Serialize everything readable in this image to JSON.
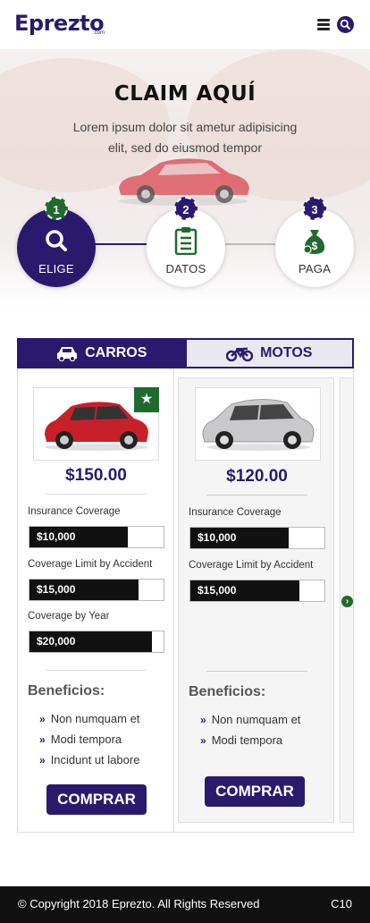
{
  "header": {
    "logo_text": "Eprezto",
    "logo_sub": ".com",
    "menu_icon": "hamburger-icon",
    "search_icon": "search-icon"
  },
  "hero": {
    "title": "CLAIM AQUÍ",
    "subtitle": "Lorem ipsum dolor sit ametur adipisicing elit, sed do eiusmod tempor"
  },
  "steps": [
    {
      "number": "1",
      "label": "ELIGE",
      "icon": "search-icon"
    },
    {
      "number": "2",
      "label": "DATOS",
      "icon": "clipboard-icon"
    },
    {
      "number": "3",
      "label": "PAGA",
      "icon": "money-bag-icon"
    }
  ],
  "tabs": [
    {
      "label": "CARROS",
      "icon": "car-icon",
      "active": true
    },
    {
      "label": "MOTOS",
      "icon": "motorcycle-icon",
      "active": false
    }
  ],
  "plans": [
    {
      "price": "$150.00",
      "car_color": "#c8202a",
      "favorite_icon": "star-icon",
      "coverages": [
        {
          "label": "Insurance Coverage",
          "value": "$10,000",
          "fill_fraction": 0.73
        },
        {
          "label": "Coverage Limit by Accident",
          "value": "$15,000",
          "fill_fraction": 0.81
        },
        {
          "label": "Coverage by Year",
          "value": "$20,000",
          "fill_fraction": 0.91
        }
      ],
      "benefits_title": "Beneficios:",
      "benefits": [
        "Non numquam et",
        "Modi tempora",
        "Incidunt ut labore"
      ],
      "button": "COMPRAR"
    },
    {
      "price": "$120.00",
      "car_color": "#c9c9cc",
      "coverages": [
        {
          "label": "Insurance Coverage",
          "value": "$10,000",
          "fill_fraction": 0.73
        },
        {
          "label": "Coverage Limit by Accident",
          "value": "$15,000",
          "fill_fraction": 0.81
        }
      ],
      "benefits_title": "Beneficios:",
      "benefits": [
        "Non numquam et",
        "Modi tempora"
      ],
      "button": "COMPRAR"
    }
  ],
  "next_icon": "arrow-right-circle-icon",
  "footer": {
    "copyright": "© Copyright 2018 Eprezto. All Rights Reserved",
    "code": "C10"
  },
  "colors": {
    "brand": "#2a1a6e",
    "accent_green": "#1f6b2d",
    "footer_bg": "#111111"
  }
}
